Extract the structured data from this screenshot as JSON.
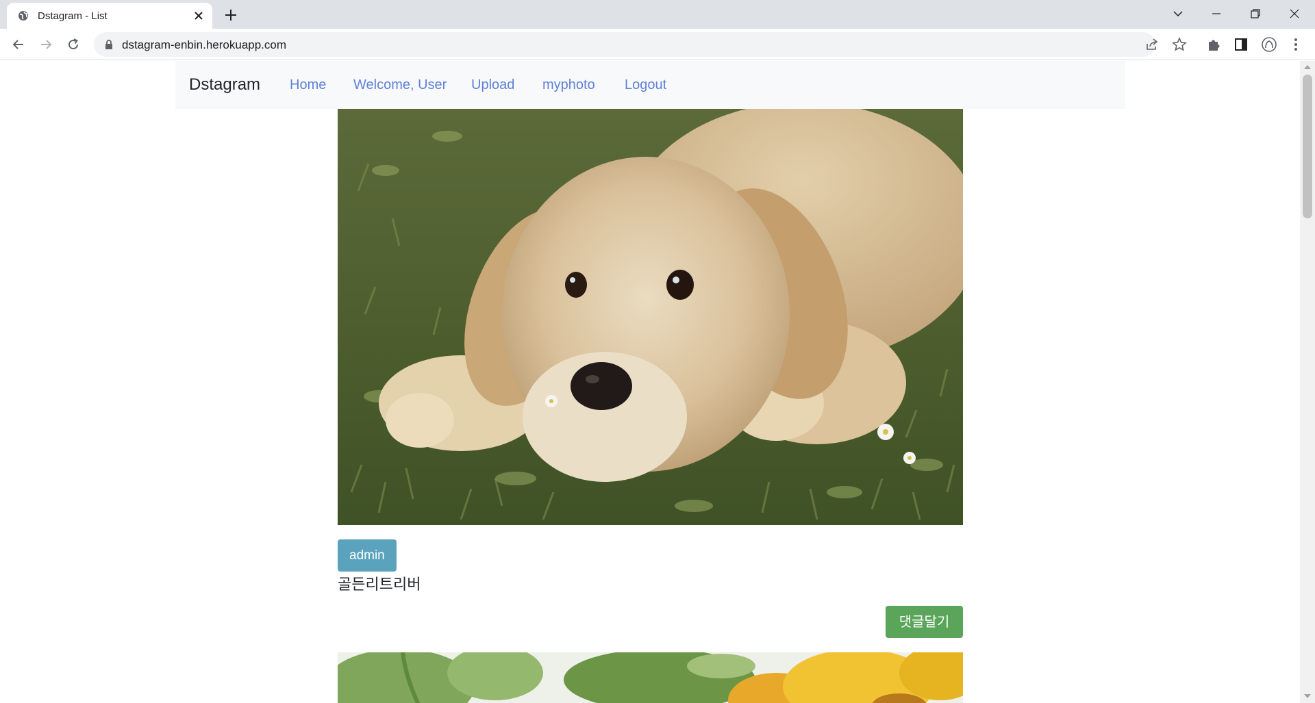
{
  "browser": {
    "tab_title": "Dstagram - List",
    "url": "dstagram-enbin.herokuapp.com"
  },
  "navbar": {
    "brand": "Dstagram",
    "links": [
      "Home",
      "Welcome, User",
      "Upload",
      "myphoto",
      "Logout"
    ]
  },
  "posts": [
    {
      "author": "admin",
      "caption": "골든리트리버",
      "comment_button": "댓글달기"
    }
  ],
  "colors": {
    "nav_link": "#5f80d6",
    "author_badge": "#5ba3bd",
    "comment_button": "#5aa55a",
    "navbar_bg": "#f8f9fa"
  }
}
